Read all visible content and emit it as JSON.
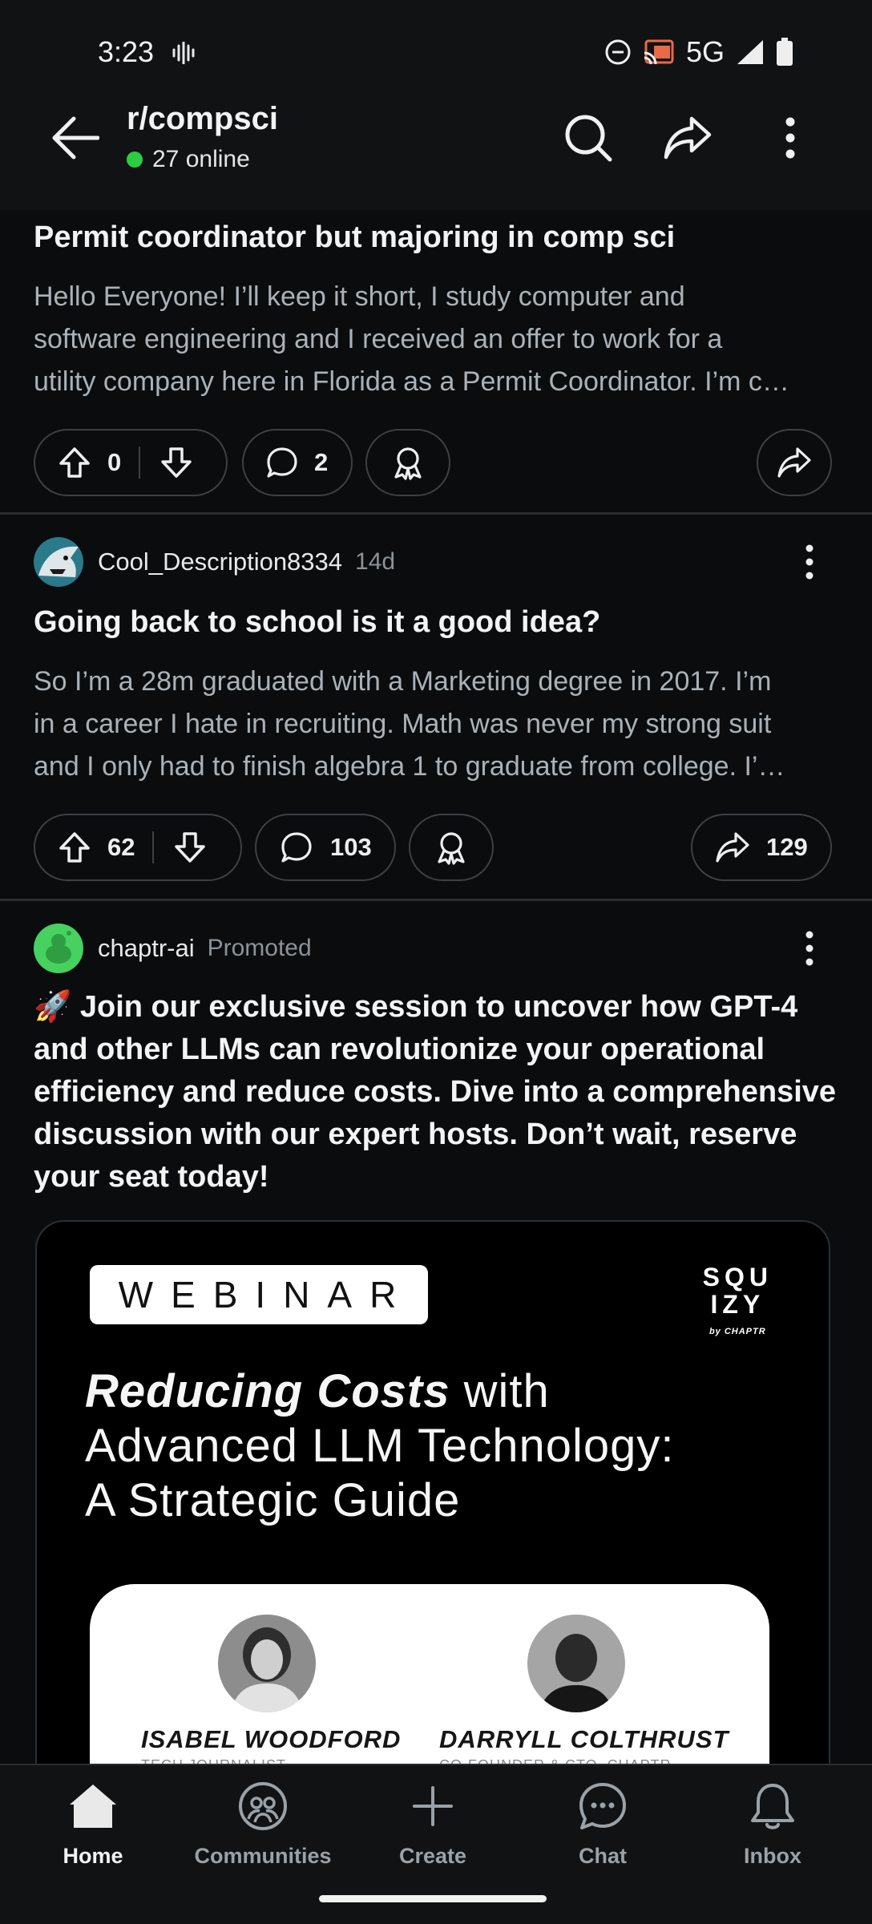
{
  "status_bar": {
    "time": "3:23",
    "network": "5G"
  },
  "header": {
    "subreddit": "r/compsci",
    "online": "27 online"
  },
  "posts": [
    {
      "title": "Permit coordinator but majoring in comp sci",
      "body_lines": [
        "Hello Everyone! I’ll keep it short, I study computer and",
        "software engineering and I received an offer to work for a",
        "utility company here in Florida as a Permit Coordinator. I’m c…"
      ],
      "votes": "0",
      "comments": "2"
    },
    {
      "author": "Cool_Description8334",
      "age": "14d",
      "title": "Going back to school is it a good idea?",
      "body_lines": [
        "So I’m a 28m graduated with a Marketing degree in 2017. I’m",
        "in a career I hate in recruiting. Math was never my strong suit",
        "and I only had to finish algebra 1 to graduate from college. I’…"
      ],
      "votes": "62",
      "comments": "103",
      "shares": "129"
    }
  ],
  "ad": {
    "author": "chaptr-ai",
    "tag": "Promoted",
    "title": "🚀 Join our exclusive session to uncover how GPT-4 and other LLMs can revolutionize your operational efficiency and reduce costs. Dive into a comprehensive discussion with our expert hosts. Don’t wait, reserve your seat today!",
    "webinar_label": "WEBINAR",
    "brand_line1": "SQU",
    "brand_line2": "IZY",
    "brand_line3": "by CHAPTR",
    "headline_emph": "Reducing Costs",
    "headline_rest1": " with",
    "headline_line2": "Advanced LLM Technology:",
    "headline_line3": "A Strategic Guide",
    "speaker1_name": "ISABEL WOODFORD",
    "speaker1_role": "TECH JOURNALIST",
    "speaker2_name": "DARRYLL COLTHRUST",
    "speaker2_role": "CO-FOUNDER & CTO, CHAPTR"
  },
  "nav": [
    {
      "label": "Home",
      "icon": "home-icon"
    },
    {
      "label": "Communities",
      "icon": "communities-icon"
    },
    {
      "label": "Create",
      "icon": "plus-icon"
    },
    {
      "label": "Chat",
      "icon": "chat-icon"
    },
    {
      "label": "Inbox",
      "icon": "bell-icon"
    }
  ],
  "colors": {
    "online_dot": "#2ecc40",
    "background": "#0b0c0d",
    "muted_text": "#a9b2b8"
  }
}
